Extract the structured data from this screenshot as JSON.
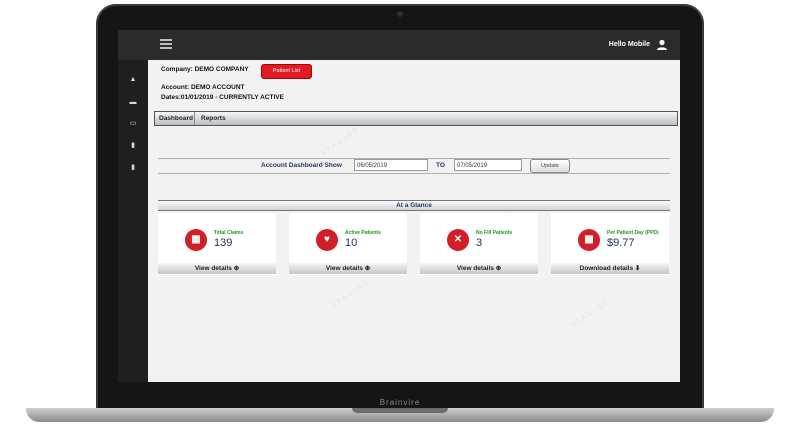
{
  "laptop": {
    "brand": "Brainvire"
  },
  "topbar": {
    "greeting": "Hello Mobile"
  },
  "sidebar": {
    "icons": [
      "graduation-cap-icon",
      "document-icon",
      "folder-icon",
      "file-icon",
      "file-icon"
    ]
  },
  "account": {
    "company": "Company: DEMO COMPANY",
    "patient_list_button": "Patient List",
    "account": "Account: DEMO ACCOUNT",
    "dates": "Dates:01/01/2019 - CURRENTLY ACTIVE"
  },
  "tabs": [
    {
      "label": "Dashboard"
    },
    {
      "label": "Reports"
    }
  ],
  "filter": {
    "label": "Account Dashboard Show",
    "from": "06/05/2019",
    "to_label": "TO",
    "to": "07/05/2019",
    "update_button": "Update"
  },
  "glance": {
    "title": "At a Glance"
  },
  "cards": [
    {
      "label": "Total Claims",
      "value": "139",
      "footer": "View details ⊕",
      "icon": "table-icon"
    },
    {
      "label": "Active Patients",
      "value": "10",
      "footer": "View details ⊕",
      "icon": "heart-pulse-icon"
    },
    {
      "label": "No Fill Patients",
      "value": "3",
      "footer": "View details ⊕",
      "icon": "x-circle-icon"
    },
    {
      "label": "Per Patient Day (PPD)",
      "value": "$9.77",
      "footer": "Download details ⬇",
      "icon": "calculator-icon"
    }
  ],
  "colors": {
    "accent_red": "#e01b24",
    "label_green": "#1a9a1a",
    "value_navy": "#1d2f5a"
  }
}
